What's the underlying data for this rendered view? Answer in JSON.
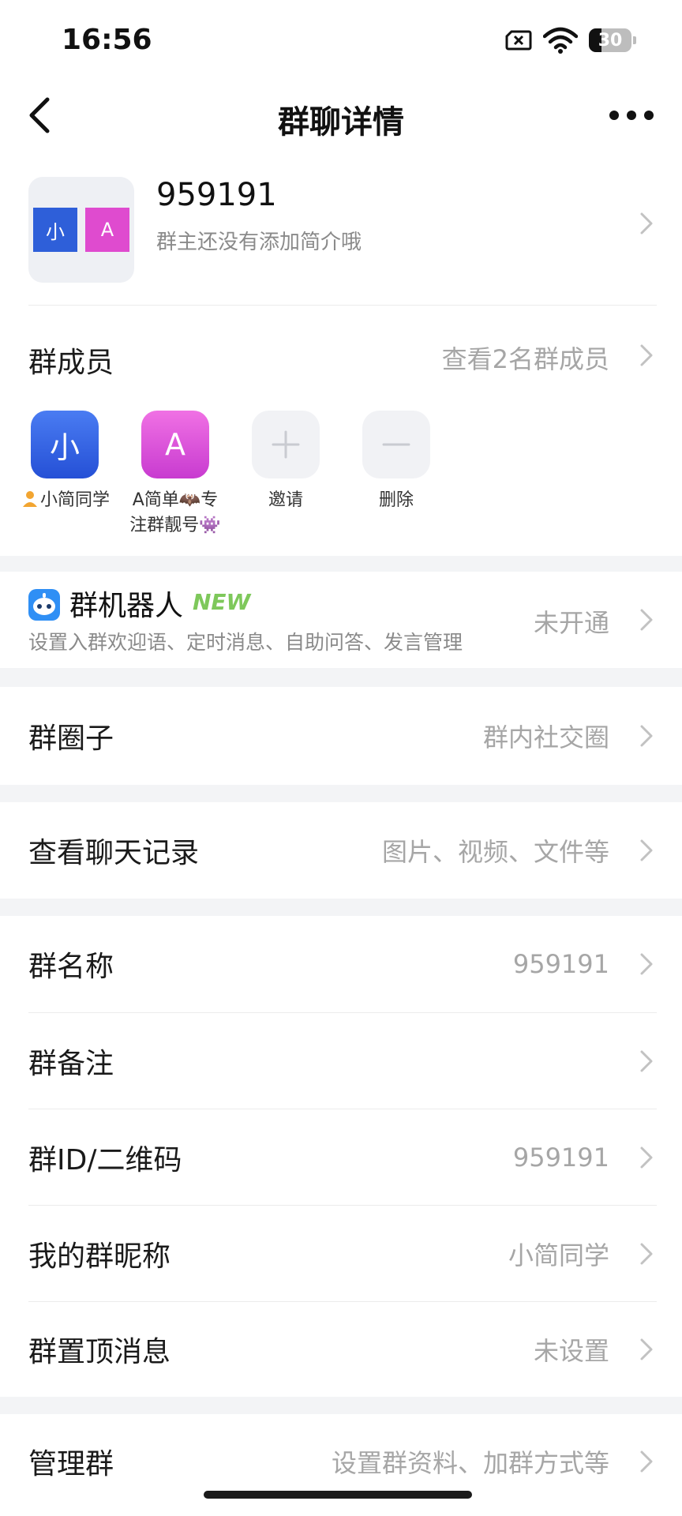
{
  "status_bar": {
    "time": "16:56",
    "battery": "30",
    "battery_level": 0.3
  },
  "nav": {
    "title": "群聊详情"
  },
  "group": {
    "avatar_left": "小",
    "avatar_right": "A",
    "name": "959191",
    "intro": "群主还没有添加简介哦"
  },
  "members": {
    "label": "群成员",
    "view_all": "查看2名群成员",
    "list": [
      {
        "avatar": "小",
        "name": "小简同学"
      },
      {
        "avatar": "A",
        "name_line1": "A简单🦇专",
        "name_line2": "注群靓号👾"
      }
    ],
    "invite": "邀请",
    "remove": "删除"
  },
  "robot": {
    "title": "群机器人",
    "badge": "NEW",
    "desc": "设置入群欢迎语、定时消息、自助问答、发言管理",
    "status": "未开通"
  },
  "rows": {
    "circle": {
      "label": "群圈子",
      "value": "群内社交圈"
    },
    "history": {
      "label": "查看聊天记录",
      "value": "图片、视频、文件等"
    },
    "group_name": {
      "label": "群名称",
      "value": "959191"
    },
    "group_remark": {
      "label": "群备注",
      "value": ""
    },
    "group_id": {
      "label": "群ID/二维码",
      "value": "959191"
    },
    "my_nickname": {
      "label": "我的群昵称",
      "value": "小简同学"
    },
    "pinned": {
      "label": "群置顶消息",
      "value": "未设置"
    },
    "manage": {
      "label": "管理群",
      "value": "设置群资料、加群方式等"
    }
  },
  "colors": {
    "accent_blue": "#2e5fd9",
    "accent_pink": "#df4bcf",
    "new_green": "#7ec85b",
    "section_gap": "#f3f4f6"
  }
}
